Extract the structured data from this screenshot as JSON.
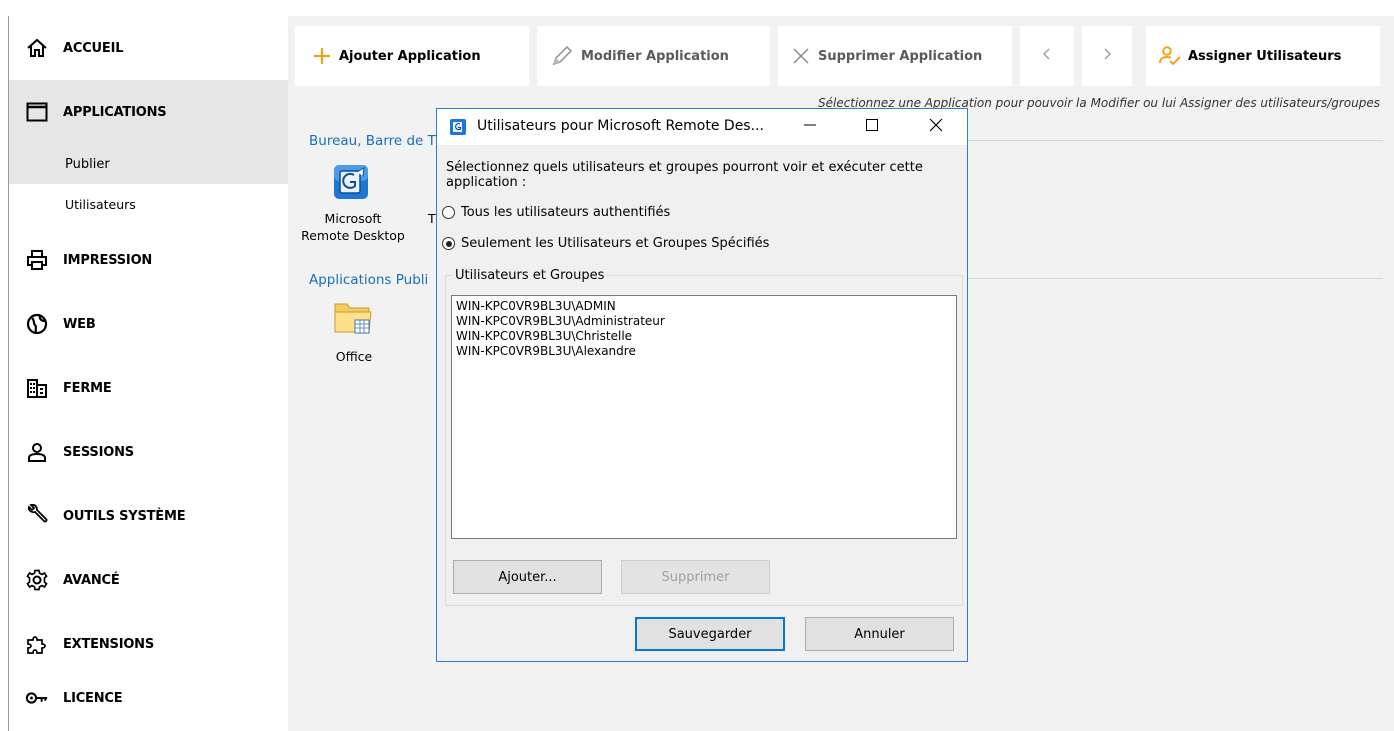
{
  "nav": {
    "accueil": "ACCUEIL",
    "applications": "APPLICATIONS",
    "publier": "Publier",
    "utilisateurs": "Utilisateurs",
    "impression": "IMPRESSION",
    "web": "WEB",
    "ferme": "FERME",
    "sessions": "SESSIONS",
    "outils": "OUTILS SYSTÈME",
    "avance": "AVANCÉ",
    "extensions": "EXTENSIONS",
    "licence": "LICENCE"
  },
  "toolbar": {
    "ajouter": "Ajouter Application",
    "modifier": "Modifier Application",
    "supprimer": "Supprimer Application",
    "assigner": "Assigner Utilisateurs"
  },
  "hint": "Sélectionnez une Application pour pouvoir la Modifier ou lui Assigner des utilisateurs/groupes",
  "sections": {
    "bureau": "Bureau, Barre de T",
    "applications_publiees": "Applications Publi"
  },
  "apps": {
    "rdp_line1": "Microsoft",
    "rdp_line2": "Remote Desktop",
    "rdp_partial": "T",
    "office": "Office"
  },
  "dialog": {
    "title": "Utilisateurs pour Microsoft Remote Des...",
    "description": "Sélectionnez quels utilisateurs et groupes pourront voir et exécuter cette application :",
    "radio_all": "Tous les utilisateurs authentifiés",
    "radio_specific": "Seulement les Utilisateurs et Groupes Spécifiés",
    "selected_radio": "specific",
    "group_label": "Utilisateurs et Groupes",
    "users": [
      "WIN-KPC0VR9BL3U\\ADMIN",
      "WIN-KPC0VR9BL3U\\Administrateur",
      "WIN-KPC0VR9BL3U\\Christelle",
      "WIN-KPC0VR9BL3U\\Alexandre"
    ],
    "btn_add": "Ajouter...",
    "btn_remove": "Supprimer",
    "btn_save": "Sauvegarder",
    "btn_cancel": "Annuler"
  },
  "colors": {
    "accent_orange": "#f5a21b",
    "link_blue": "#1b6dc1",
    "dialog_border": "#2b7fd6"
  }
}
